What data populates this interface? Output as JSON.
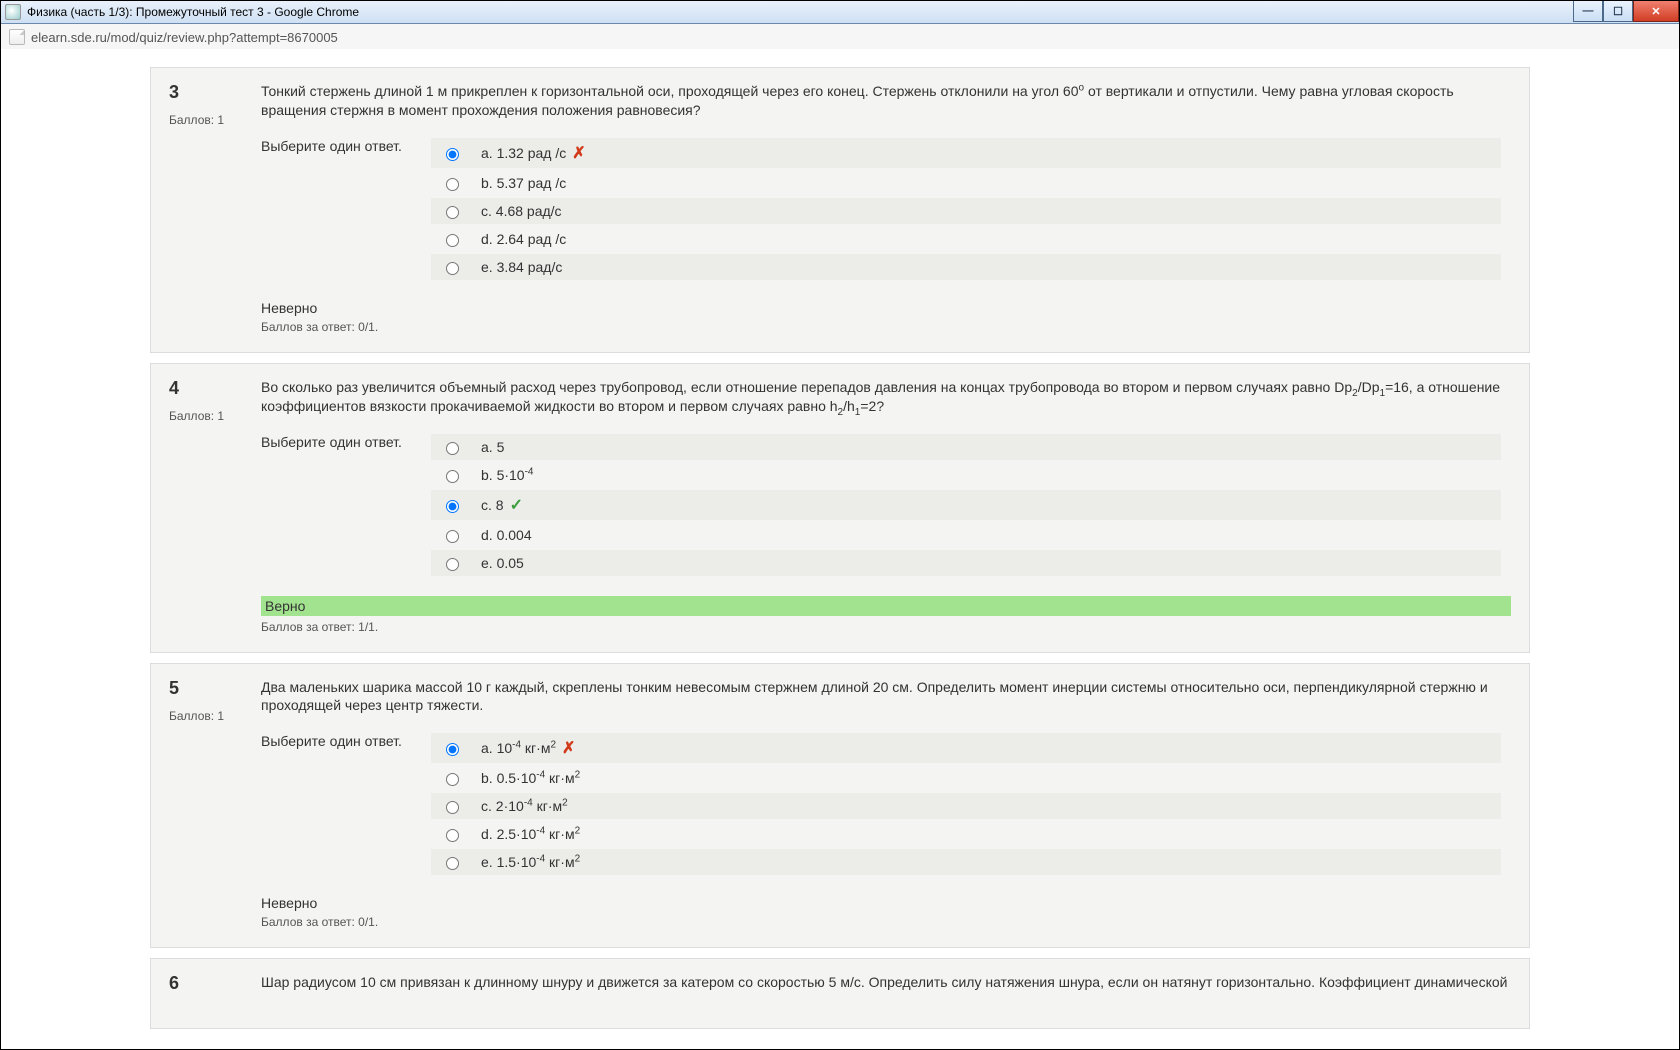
{
  "window": {
    "title": "Физика (часть 1/3): Промежуточный тест 3 - Google Chrome",
    "url": "elearn.sde.ru/mod/quiz/review.php?attempt=8670005"
  },
  "questions": [
    {
      "num": "3",
      "grade_label": "Баллов: 1",
      "text_html": "Тонкий стержень длиной 1 м прикреплен к горизонтальной оси, проходящей через его конец. Стержень отклонили на угол 60<sup>o</sup> от вертикали и отпустили. Чему равна угловая скорость вращения стержня в момент прохождения положения равновесия?",
      "prompt": "Выберите один ответ.",
      "answers": [
        {
          "label_html": "a. 1.32 рад /с",
          "selected": true,
          "mark": "wrong"
        },
        {
          "label_html": "b. 5.37 рад /с",
          "selected": false
        },
        {
          "label_html": "c. 4.68 рад/с",
          "selected": false
        },
        {
          "label_html": "d. 2.64 рад /с",
          "selected": false
        },
        {
          "label_html": "e. 3.84 рад/с",
          "selected": false
        }
      ],
      "feedback": "Неверно",
      "feedback_correct": false,
      "score": "Баллов за ответ: 0/1."
    },
    {
      "num": "4",
      "grade_label": "Баллов: 1",
      "text_html": "Во сколько раз увеличится объемный расход через трубопровод, если отношение перепадов давления на концах трубопровода во втором и первом случаях равно Dp<sub>2</sub>/Dp<sub>1</sub>=16, а отношение коэффициентов вязкости прокачиваемой жидкости во втором и первом случаях равно h<sub>2</sub>/h<sub>1</sub>=2?",
      "prompt": "Выберите один ответ.",
      "answers": [
        {
          "label_html": "a. 5",
          "selected": false
        },
        {
          "label_html": "b. 5·10<sup>-4</sup>",
          "selected": false
        },
        {
          "label_html": "c. 8",
          "selected": true,
          "mark": "right"
        },
        {
          "label_html": "d. 0.004",
          "selected": false
        },
        {
          "label_html": "e. 0.05",
          "selected": false
        }
      ],
      "feedback": "Верно",
      "feedback_correct": true,
      "score": "Баллов за ответ: 1/1."
    },
    {
      "num": "5",
      "grade_label": "Баллов: 1",
      "text_html": "Два маленьких шарика массой 10 г каждый, скреплены тонким невесомым стержнем длиной 20 см. Определить момент инерции системы относительно оси, перпендикулярной стержню и проходящей через центр тяжести.",
      "prompt": "Выберите один ответ.",
      "answers": [
        {
          "label_html": "a. 10<sup>-4</sup> кг·м<sup>2</sup>",
          "selected": true,
          "mark": "wrong"
        },
        {
          "label_html": "b. 0.5·10<sup>-4</sup> кг·м<sup>2</sup>",
          "selected": false
        },
        {
          "label_html": "c. 2·10<sup>-4</sup> кг·м<sup>2</sup>",
          "selected": false
        },
        {
          "label_html": "d. 2.5·10<sup>-4</sup> кг·м<sup>2</sup>",
          "selected": false
        },
        {
          "label_html": "e. 1.5·10<sup>-4</sup> кг·м<sup>2</sup>",
          "selected": false
        }
      ],
      "feedback": "Неверно",
      "feedback_correct": false,
      "score": "Баллов за ответ: 0/1."
    },
    {
      "num": "6",
      "grade_label": "",
      "text_html": "Шар радиусом 10 см привязан к длинному шнуру и движется за катером со скоростью 5 м/с. Определить силу натяжения шнура, если он натянут горизонтально. Коэффициент динамической",
      "prompt": "",
      "answers": [],
      "feedback": "",
      "feedback_correct": false,
      "score": ""
    }
  ]
}
